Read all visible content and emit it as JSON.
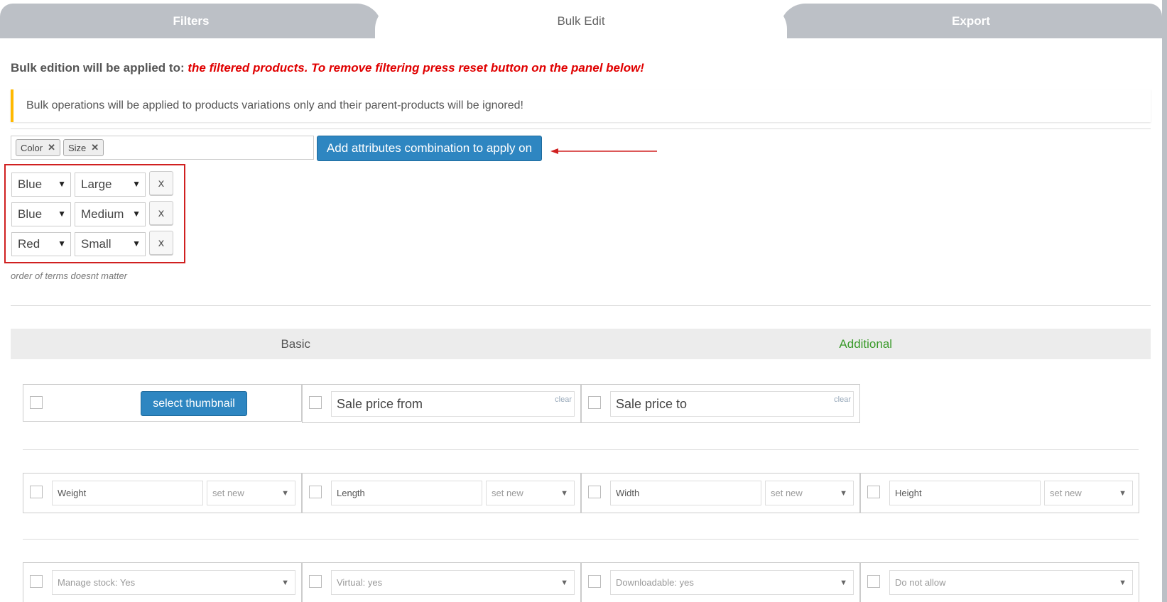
{
  "tabs": {
    "filters": "Filters",
    "bulk_edit": "Bulk Edit",
    "export": "Export"
  },
  "bulk": {
    "applied_label": "Bulk edition will be applied to:",
    "applied_note": "the filtered products. To remove filtering press reset button on the panel below!",
    "notice": "Bulk operations will be applied to products variations only and their parent-products will be ignored!"
  },
  "attributes": {
    "chips": [
      {
        "label": "Color",
        "remove": "✕"
      },
      {
        "label": "Size",
        "remove": "✕"
      }
    ],
    "add_button": "Add attributes combination to apply on",
    "combinations": [
      {
        "color": "Blue",
        "size": "Large",
        "remove": "x"
      },
      {
        "color": "Blue",
        "size": "Medium",
        "remove": "x"
      },
      {
        "color": "Red",
        "size": "Small",
        "remove": "x"
      }
    ],
    "hint": "order of terms doesnt matter"
  },
  "subtabs": {
    "basic": "Basic",
    "additional": "Additional"
  },
  "fields": {
    "thumbnail_button": "select thumbnail",
    "sale_price_from": "Sale price from",
    "sale_price_to": "Sale price to",
    "clear": "clear",
    "weight": "Weight",
    "length": "Length",
    "width": "Width",
    "height": "Height",
    "set_new": "set new",
    "manage_stock": "Manage stock: Yes",
    "virtual": "Virtual: yes",
    "downloadable": "Downloadable: yes",
    "backorders": "Do not allow"
  },
  "colors": {
    "accent": "#2e86c1",
    "warning": "#ffb900",
    "error": "#e00000",
    "active_subtab": "#3a9a2a"
  }
}
